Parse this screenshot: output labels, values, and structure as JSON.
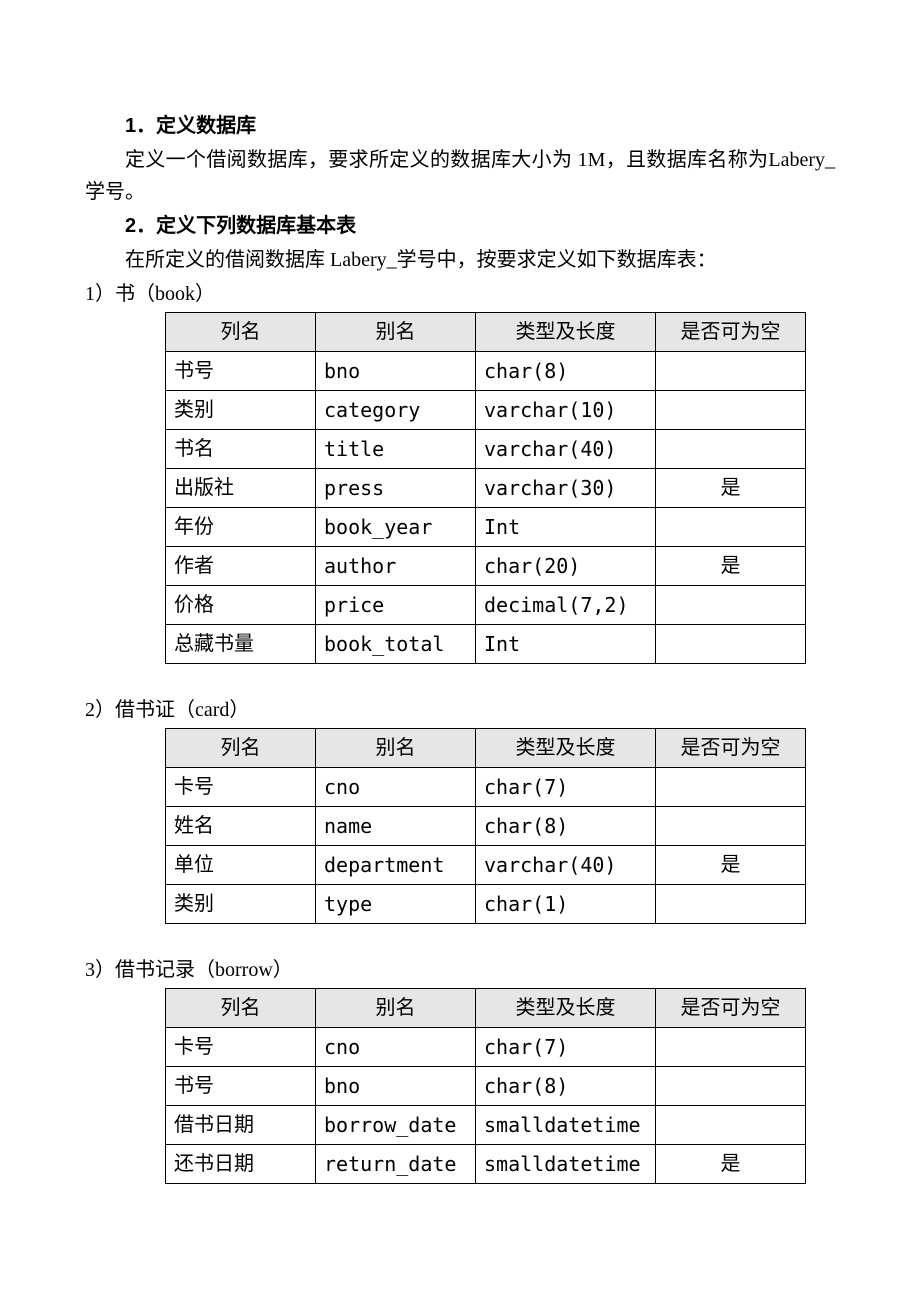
{
  "section1": {
    "heading": "1．定义数据库",
    "paragraph": "定义一个借阅数据库，要求所定义的数据库大小为 1M，且数据库名称为Labery_学号。"
  },
  "section2": {
    "heading": "2．定义下列数据库基本表",
    "paragraph": "在所定义的借阅数据库 Labery_学号中，按要求定义如下数据库表："
  },
  "headers": {
    "col1": "列名",
    "col2": "别名",
    "col3": "类型及长度",
    "col4": "是否可为空"
  },
  "tables": [
    {
      "label": "1）书（book）",
      "rows": [
        {
          "name": "书号",
          "alias": "bno",
          "type": "char(8)",
          "nullable": ""
        },
        {
          "name": "类别",
          "alias": "category",
          "type": "varchar(10)",
          "nullable": ""
        },
        {
          "name": "书名",
          "alias": "title",
          "type": "varchar(40)",
          "nullable": ""
        },
        {
          "name": "出版社",
          "alias": "press",
          "type": "varchar(30)",
          "nullable": "是"
        },
        {
          "name": "年份",
          "alias": "book_year",
          "type": "Int",
          "nullable": ""
        },
        {
          "name": "作者",
          "alias": "author",
          "type": "char(20)",
          "nullable": "是"
        },
        {
          "name": "价格",
          "alias": "price",
          "type": "decimal(7,2)",
          "nullable": ""
        },
        {
          "name": "总藏书量",
          "alias": "book_total",
          "type": "Int",
          "nullable": ""
        }
      ]
    },
    {
      "label": "2）借书证（card）",
      "rows": [
        {
          "name": "卡号",
          "alias": "cno",
          "type": "char(7)",
          "nullable": ""
        },
        {
          "name": "姓名",
          "alias": "name",
          "type": "char(8)",
          "nullable": ""
        },
        {
          "name": "单位",
          "alias": "department",
          "type": "varchar(40)",
          "nullable": "是"
        },
        {
          "name": "类别",
          "alias": "type",
          "type": "char(1)",
          "nullable": ""
        }
      ]
    },
    {
      "label": "3）借书记录（borrow）",
      "rows": [
        {
          "name": "卡号",
          "alias": "cno",
          "type": "char(7)",
          "nullable": ""
        },
        {
          "name": "书号",
          "alias": "bno",
          "type": "char(8)",
          "nullable": ""
        },
        {
          "name": "借书日期",
          "alias": "borrow_date",
          "type": "smalldatetime",
          "nullable": ""
        },
        {
          "name": "还书日期",
          "alias": "return_date",
          "type": "smalldatetime",
          "nullable": "是"
        }
      ]
    }
  ]
}
